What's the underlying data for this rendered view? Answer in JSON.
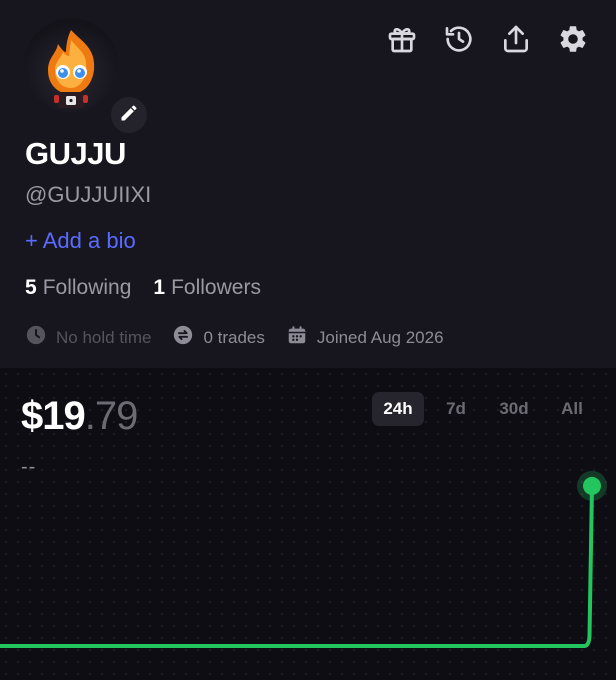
{
  "profile": {
    "name": "GUJJU",
    "handle": "@GUJJUIIXI",
    "add_bio": "+ Add a bio",
    "following_count": "5",
    "following_label": "Following",
    "followers_count": "1",
    "followers_label": "Followers",
    "hold_time": "No hold time",
    "trades": "0 trades",
    "joined": "Joined Aug 2026"
  },
  "header_icons": [
    "gift-icon",
    "history-icon",
    "share-icon",
    "settings-icon"
  ],
  "portfolio": {
    "balance_whole": "$19",
    "balance_cents": ".79",
    "change": "--",
    "ranges": [
      "24h",
      "7d",
      "30d",
      "All"
    ],
    "selected_range": "24h"
  },
  "colors": {
    "accent_link": "#5b6bff",
    "chart_line": "#22c55e",
    "background": "#17161f",
    "chart_background": "#0e0d14"
  },
  "chart_data": {
    "type": "line",
    "series": [
      {
        "values": [
          0,
          0,
          0,
          0,
          0,
          0,
          0,
          0,
          0,
          0,
          0,
          0,
          0,
          0,
          0,
          0,
          0,
          0,
          0,
          0,
          0,
          0,
          0,
          0,
          19.79
        ]
      }
    ],
    "ylim": [
      0,
      22
    ],
    "grid": false
  }
}
